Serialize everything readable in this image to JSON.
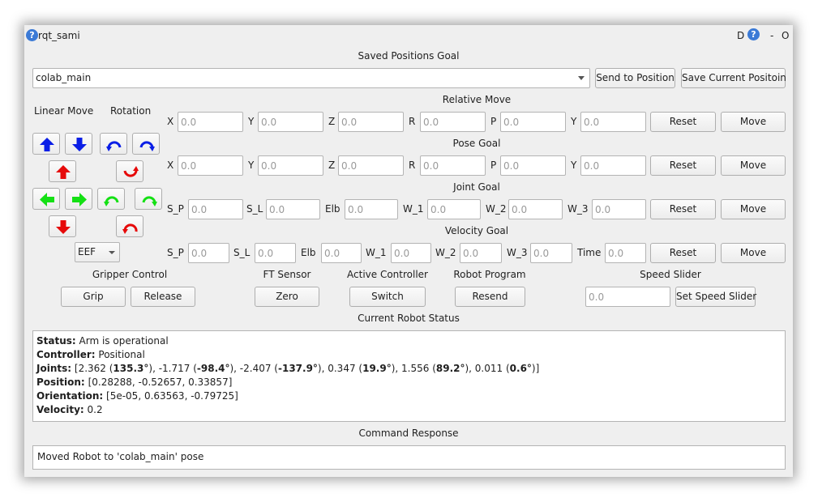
{
  "window": {
    "title": "rqt_sami",
    "right_controls": {
      "d": "D",
      "minus": "-",
      "o": "O"
    }
  },
  "saved_positions": {
    "title": "Saved Positions Goal",
    "selected": "colab_main",
    "send_button": "Send to Position",
    "save_button": "Save Current Positoin"
  },
  "linear_move": {
    "label": "Linear Move"
  },
  "rotation": {
    "label": "Rotation"
  },
  "frame_select": {
    "value": "EEF"
  },
  "relative_move": {
    "title": "Relative Move",
    "fields": [
      {
        "label": "X",
        "placeholder": "0.0"
      },
      {
        "label": "Y",
        "placeholder": "0.0"
      },
      {
        "label": "Z",
        "placeholder": "0.0"
      },
      {
        "label": "R",
        "placeholder": "0.0"
      },
      {
        "label": "P",
        "placeholder": "0.0"
      },
      {
        "label": "Y",
        "placeholder": "0.0"
      }
    ],
    "reset": "Reset",
    "move": "Move"
  },
  "pose_goal": {
    "title": "Pose Goal",
    "fields": [
      {
        "label": "X",
        "placeholder": "0.0"
      },
      {
        "label": "Y",
        "placeholder": "0.0"
      },
      {
        "label": "Z",
        "placeholder": "0.0"
      },
      {
        "label": "R",
        "placeholder": "0.0"
      },
      {
        "label": "P",
        "placeholder": "0.0"
      },
      {
        "label": "Y",
        "placeholder": "0.0"
      }
    ],
    "reset": "Reset",
    "move": "Move"
  },
  "joint_goal": {
    "title": "Joint Goal",
    "fields": [
      {
        "label": "S_P",
        "placeholder": "0.0"
      },
      {
        "label": "S_L",
        "placeholder": "0.0"
      },
      {
        "label": "Elb",
        "placeholder": "0.0"
      },
      {
        "label": "W_1",
        "placeholder": "0.0"
      },
      {
        "label": "W_2",
        "placeholder": "0.0"
      },
      {
        "label": "W_3",
        "placeholder": "0.0"
      }
    ],
    "reset": "Reset",
    "move": "Move"
  },
  "velocity_goal": {
    "title": "Velocity Goal",
    "fields": [
      {
        "label": "S_P",
        "placeholder": "0.0"
      },
      {
        "label": "S_L",
        "placeholder": "0.0"
      },
      {
        "label": "Elb",
        "placeholder": "0.0"
      },
      {
        "label": "W_1",
        "placeholder": "0.0"
      },
      {
        "label": "W_2",
        "placeholder": "0.0"
      },
      {
        "label": "W_3",
        "placeholder": "0.0"
      },
      {
        "label": "Time",
        "placeholder": "0.0"
      }
    ],
    "reset": "Reset",
    "move": "Move"
  },
  "gripper": {
    "title": "Gripper Control",
    "grip": "Grip",
    "release": "Release"
  },
  "ft_sensor": {
    "title": "FT Sensor",
    "zero": "Zero"
  },
  "active_controller": {
    "title": "Active Controller",
    "switch": "Switch"
  },
  "robot_program": {
    "title": "Robot Program",
    "resend": "Resend"
  },
  "speed_slider": {
    "title": "Speed Slider",
    "placeholder": "0.0",
    "set_button": "Set Speed Slider"
  },
  "status": {
    "title": "Current Robot Status",
    "status_label": "Status:",
    "status_value": "Arm is operational",
    "controller_label": "Controller:",
    "controller_value": "Positional",
    "joints_label": "Joints:",
    "joints_open": "[",
    "joints": [
      {
        "rad": "2.362",
        "deg": "135.3°"
      },
      {
        "rad": "-1.717",
        "deg": "-98.4°"
      },
      {
        "rad": "-2.407",
        "deg": "-137.9°"
      },
      {
        "rad": "0.347",
        "deg": "19.9°"
      },
      {
        "rad": "1.556",
        "deg": "89.2°"
      },
      {
        "rad": "0.011",
        "deg": "0.6°"
      }
    ],
    "joints_close": "]",
    "position_label": "Position:",
    "position_value": "[0.28288, -0.52657, 0.33857]",
    "orientation_label": "Orientation:",
    "orientation_value": "[5e-05, 0.63563, -0.79725]",
    "velocity_label": "Velocity:",
    "velocity_value": "0.2"
  },
  "command_response": {
    "title": "Command Response",
    "text": "Moved Robot to 'colab_main' pose"
  },
  "colors": {
    "move_blue": "#0a1ee6",
    "move_red": "#e60a0a",
    "move_green": "#14e014",
    "window_bg": "#efefef"
  }
}
